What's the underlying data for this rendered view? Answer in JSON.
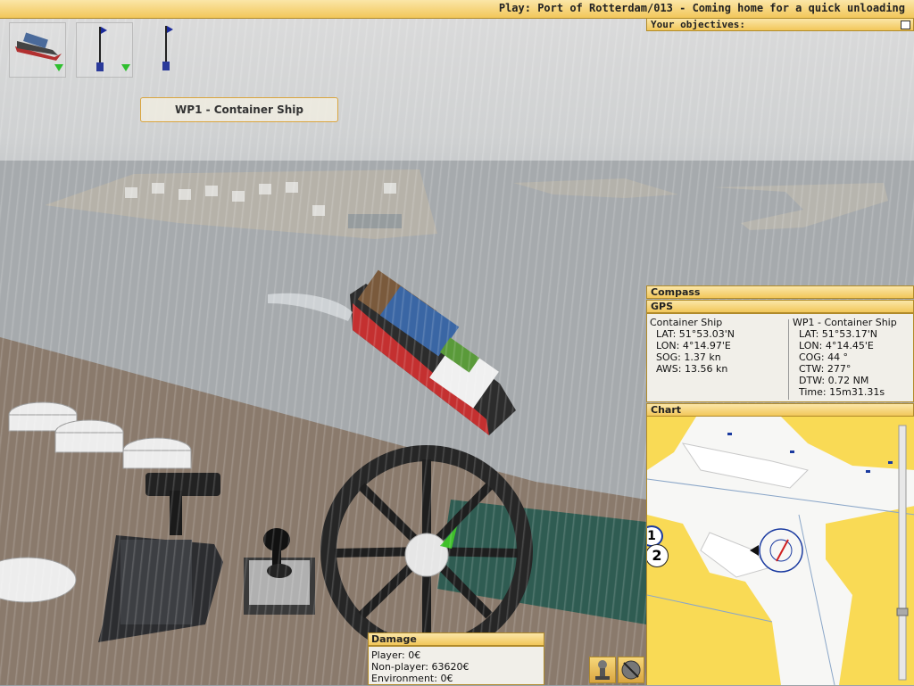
{
  "title": "Play: Port of Rotterdam/013 - Coming home for a quick unloading",
  "objectives": {
    "label": "Your objectives:"
  },
  "waypoint_label": "WP1 - Container Ship",
  "compass": {
    "label": "Compass"
  },
  "gps": {
    "label": "GPS",
    "own": {
      "name": "Container Ship",
      "rows": [
        "LAT: 51°53.03'N",
        "LON: 4°14.97'E",
        "SOG: 1.37 kn",
        "AWS: 13.56 kn"
      ]
    },
    "target": {
      "name": "WP1 - Container Ship",
      "rows": [
        "LAT: 51°53.17'N",
        "LON: 4°14.45'E",
        "COG: 44 °",
        "CTW: 277°",
        "DTW: 0.72 NM",
        "Time: 15m31.31s"
      ]
    }
  },
  "chart": {
    "label": "Chart",
    "markers": [
      "1",
      "2"
    ]
  },
  "damage": {
    "label": "Damage",
    "rows": [
      "Player: 0€",
      "Non-player: 63620€",
      "Environment: 0€"
    ]
  },
  "icons": [
    "ship-thumbnail-icon",
    "waypoint-flag-icon",
    "buoy-flag-icon",
    "anchor-icon",
    "horn-off-icon",
    "compass-icon"
  ],
  "colors": {
    "hud_yellow": "#f2c75a",
    "panel_bg": "#f1efe9",
    "hud_border": "#b08a2a"
  }
}
